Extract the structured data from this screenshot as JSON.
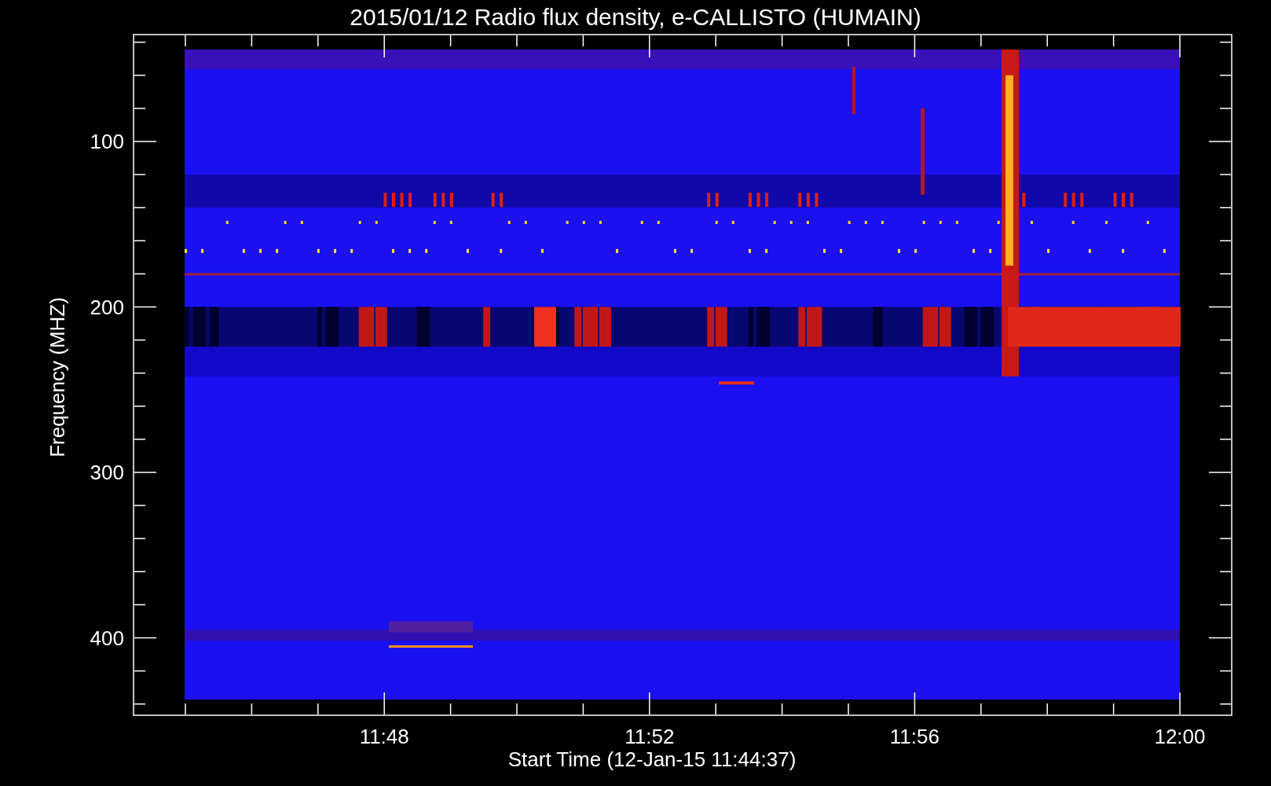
{
  "plot": {
    "title": "2015/01/12  Radio flux density, e-CALLISTO (HUMAIN)",
    "ylabel": "Frequency (MHZ)",
    "yticks": [
      "100",
      "200",
      "300",
      "400"
    ],
    "xticks": [
      "11:48",
      "11:52",
      "11:56",
      "12:00"
    ],
    "xlabel": "Start Time (12-Jan-15 11:44:37)"
  }
}
